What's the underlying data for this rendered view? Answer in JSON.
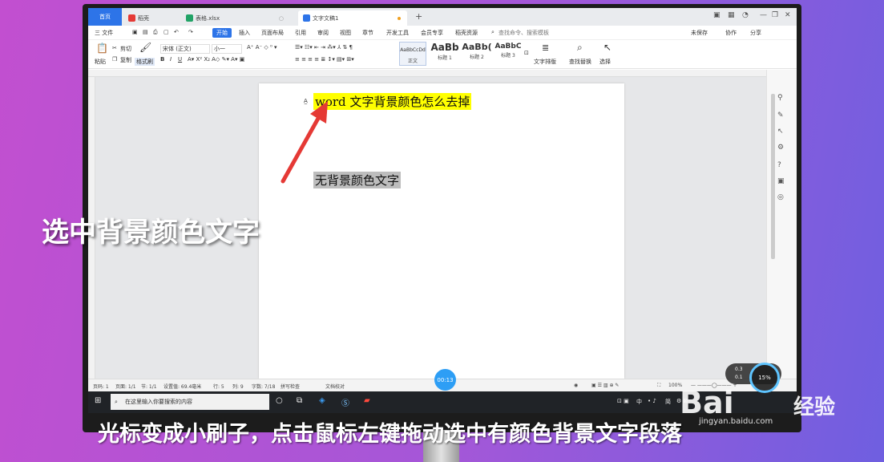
{
  "tabs": [
    {
      "label": "首页",
      "active": false
    },
    {
      "label": "稻壳",
      "active": false,
      "icon_color": "#e53935"
    },
    {
      "label": "表格.xlsx",
      "active": false,
      "icon_color": "#21a366"
    },
    {
      "label": "文字文稿1",
      "active": true,
      "icon_color": "#2d74e8"
    }
  ],
  "new_tab": "+",
  "menu": {
    "file": "三 文件",
    "items": [
      "开始",
      "插入",
      "页面布局",
      "引用",
      "审阅",
      "视图",
      "章节",
      "开发工具",
      "会员专享",
      "稻壳资源"
    ],
    "active": "开始",
    "search": "查找命令、搜索模板",
    "right": [
      "未保存",
      "协作",
      "分享"
    ]
  },
  "ribbon": {
    "paste": "粘贴",
    "cut": "剪切",
    "copy": "复制",
    "format_painter": "格式刷",
    "font_name": "宋体 (正文)",
    "font_size": "小一",
    "styles": [
      {
        "preview": "AaBbCcDd",
        "label": "正文"
      },
      {
        "preview": "AaBb",
        "label": "标题 1"
      },
      {
        "preview": "AaBb(",
        "label": "标题 2"
      },
      {
        "preview": "AaBbC",
        "label": "标题 3"
      }
    ],
    "text_layout": "文字排版",
    "find_replace": "查找替换",
    "select": "选择"
  },
  "document": {
    "line1": "word 文字背景颜色怎么去掉",
    "line2": "无背景颜色文字",
    "line1_bg": "#ffff00",
    "line2_bg": "#bdbdbd"
  },
  "status": {
    "page": "页码: 1",
    "pages": "页面: 1/1",
    "section": "节: 1/1",
    "setting": "设置值: 69.4毫米",
    "row": "行: 5",
    "col": "列: 9",
    "words": "字数: 7/18",
    "spell": "拼写检查",
    "proof": "文档校对",
    "zoom": "100%"
  },
  "taskbar": {
    "search_placeholder": "在这里输入你要搜索的内容",
    "tray_ime": "中",
    "tray_simp": "简"
  },
  "overlay": {
    "caption": "选中背景颜色文字",
    "subtitle": "光标变成小刷子，点击鼠标左键拖动选中有颜色背景文字段落",
    "timer": "00:13",
    "widget_a": "0.3",
    "widget_b": "0.1",
    "gauge": "15%"
  },
  "watermark": {
    "brand": "Bai",
    "brand2": "经验",
    "url": "jingyan.baidu.com"
  },
  "colors": {
    "accent": "#2d74e8",
    "arrow": "#e53935"
  }
}
